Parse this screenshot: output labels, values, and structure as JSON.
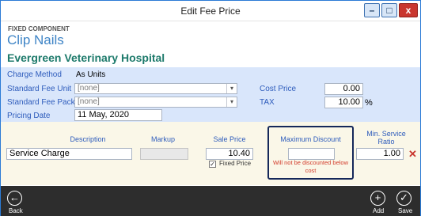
{
  "window": {
    "title": "Edit Fee Price",
    "minimize_glyph": "–",
    "maximize_glyph": "□",
    "close_glyph": "x"
  },
  "header": {
    "component_type": "FIXED COMPONENT",
    "component_name": "Clip Nails",
    "hospital_name": "Evergreen Veterinary Hospital"
  },
  "settings": {
    "charge_method_label": "Charge Method",
    "charge_method_value": "As Units",
    "standard_fee_unit_label": "Standard Fee Unit",
    "standard_fee_unit_value": "[none]",
    "standard_fee_pack_label": "Standard Fee Pack",
    "standard_fee_pack_value": "[none]",
    "pricing_date_label": "Pricing Date",
    "pricing_date_value": "11 May, 2020",
    "cost_price_label": "Cost Price",
    "cost_price_value": "0.00",
    "tax_label": "TAX",
    "tax_value": "10.00",
    "tax_unit": "%"
  },
  "pricing": {
    "headers": {
      "description": "Description",
      "markup": "Markup",
      "sale_price": "Sale Price",
      "maximum_discount": "Maximum Discount",
      "min_service_ratio_line1": "Min. Service",
      "min_service_ratio_line2": "Ratio"
    },
    "row": {
      "description": "Service Charge",
      "markup": "",
      "sale_price": "10.40",
      "fixed_price_label": "Fixed Price",
      "fixed_price_checked": true,
      "maximum_discount": "",
      "discount_warning": "Will not be discounted below cost",
      "min_service_ratio": "1.00"
    },
    "delete_glyph": "✕"
  },
  "bottom_bar": {
    "back_label": "Back",
    "add_label": "Add",
    "save_label": "Save"
  },
  "icons": {
    "back": "arrow-left-circle",
    "add": "plus-circle",
    "save": "check-circle",
    "dropdown": "chevron-down"
  },
  "colors": {
    "label_blue": "#2e5cbc",
    "title_blue": "#3e84c6",
    "hospital_green": "#1d7a6b",
    "settings_bg": "#d9e6fb",
    "pricing_bg": "#faf7e8",
    "warning_red": "#d23b2b",
    "bottom_bar": "#2d2d2d"
  }
}
